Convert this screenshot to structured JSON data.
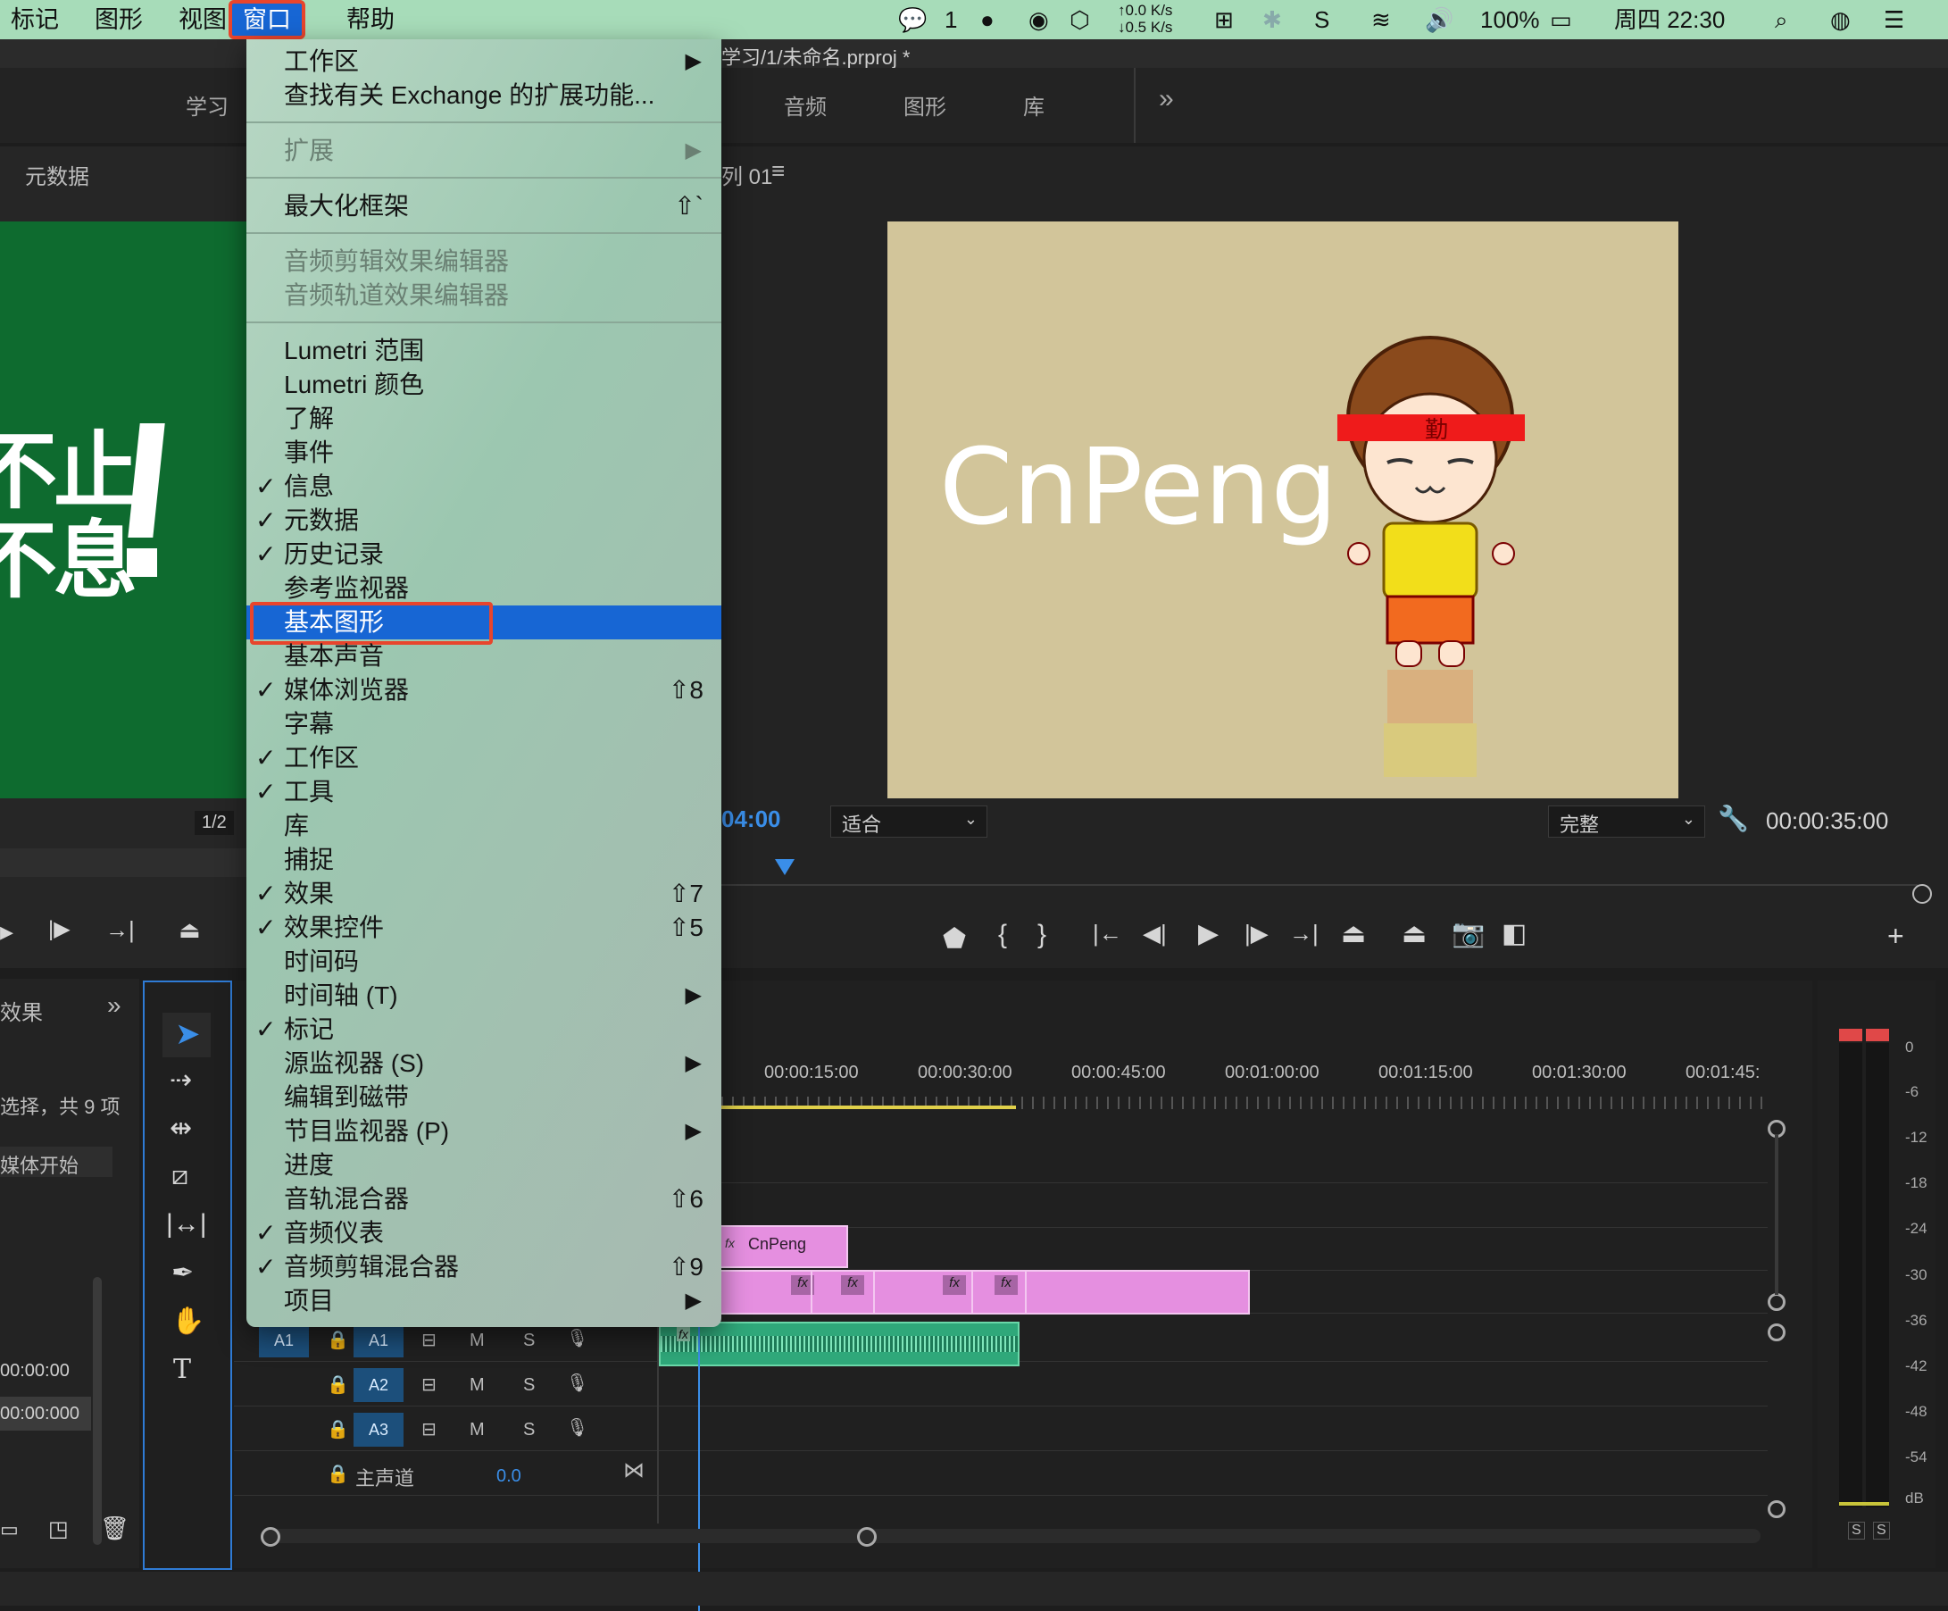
{
  "menubar": {
    "items": [
      "标记",
      "图形",
      "视图",
      "窗口",
      "帮助"
    ],
    "active": "窗口",
    "status": {
      "wechat_count": "1",
      "net_up": "↑0.0 K/s",
      "net_down": "↓0.5 K/s",
      "battery": "100%",
      "clock": "周四 22:30"
    }
  },
  "titlebar": {
    "project_path": "学习/1/未命名.prproj *"
  },
  "workspaces": [
    "学习",
    "音频",
    "图形",
    "库"
  ],
  "source_panel": {
    "title": "元数据",
    "poster_line1": "不止",
    "poster_line2": "不息",
    "page_indicator": "1/2"
  },
  "program_panel": {
    "sequence_name": "序列 01",
    "sequence_suffix": "列 01",
    "preview_text": "CnPeng",
    "headband_char": "勤",
    "current_time": "04:00",
    "fit_select": "适合",
    "quality_select": "完整",
    "duration": "00:00:35:00"
  },
  "project_panel": {
    "tab": "效果",
    "selection_info": "选择，共 9 项",
    "column": "媒体开始",
    "row1": "00:00:00",
    "row2": "00:00:000"
  },
  "timeline": {
    "ruler": [
      "00:00:15:00",
      "00:00:30:00",
      "00:00:45:00",
      "00:01:00:00",
      "00:01:15:00",
      "00:01:30:00",
      "00:01:45:"
    ],
    "tracks": [
      {
        "src": "A1",
        "name": "A1",
        "m": "M",
        "s": "S"
      },
      {
        "src": "",
        "name": "A2",
        "m": "M",
        "s": "S"
      },
      {
        "src": "",
        "name": "A3",
        "m": "M",
        "s": "S"
      }
    ],
    "master_label": "主声道",
    "master_value": "0.0",
    "clip_title": "CnPeng",
    "fx": "fx"
  },
  "audio_meter": {
    "scale": [
      "0",
      "-6",
      "-12",
      "-18",
      "-24",
      "-30",
      "-36",
      "-42",
      "-48",
      "-54",
      "dB"
    ],
    "solo": [
      "S",
      "S"
    ]
  },
  "window_menu": {
    "items": [
      {
        "label": "工作区",
        "check": false,
        "shortcut": "",
        "submenu": true,
        "disabled": false
      },
      {
        "label": "查找有关 Exchange 的扩展功能...",
        "check": false,
        "shortcut": "",
        "submenu": false,
        "disabled": false
      },
      {
        "label": "扩展",
        "check": false,
        "shortcut": "",
        "submenu": true,
        "disabled": true
      },
      {
        "label": "最大化框架",
        "check": false,
        "shortcut": "⇧`",
        "submenu": false,
        "disabled": false
      },
      {
        "label": "音频剪辑效果编辑器",
        "check": false,
        "shortcut": "",
        "submenu": false,
        "disabled": true
      },
      {
        "label": "音频轨道效果编辑器",
        "check": false,
        "shortcut": "",
        "submenu": false,
        "disabled": true
      },
      {
        "label": "Lumetri 范围",
        "check": false,
        "shortcut": "",
        "submenu": false,
        "disabled": false
      },
      {
        "label": "Lumetri 颜色",
        "check": false,
        "shortcut": "",
        "submenu": false,
        "disabled": false
      },
      {
        "label": "了解",
        "check": false,
        "shortcut": "",
        "submenu": false,
        "disabled": false
      },
      {
        "label": "事件",
        "check": false,
        "shortcut": "",
        "submenu": false,
        "disabled": false
      },
      {
        "label": "信息",
        "check": true,
        "shortcut": "",
        "submenu": false,
        "disabled": false
      },
      {
        "label": "元数据",
        "check": true,
        "shortcut": "",
        "submenu": false,
        "disabled": false
      },
      {
        "label": "历史记录",
        "check": true,
        "shortcut": "",
        "submenu": false,
        "disabled": false
      },
      {
        "label": "参考监视器",
        "check": false,
        "shortcut": "",
        "submenu": false,
        "disabled": false
      },
      {
        "label": "基本图形",
        "check": false,
        "shortcut": "",
        "submenu": false,
        "disabled": false,
        "highlighted": true
      },
      {
        "label": "基本声音",
        "check": false,
        "shortcut": "",
        "submenu": false,
        "disabled": false
      },
      {
        "label": "媒体浏览器",
        "check": true,
        "shortcut": "⇧8",
        "submenu": false,
        "disabled": false
      },
      {
        "label": "字幕",
        "check": false,
        "shortcut": "",
        "submenu": false,
        "disabled": false
      },
      {
        "label": "工作区",
        "check": true,
        "shortcut": "",
        "submenu": false,
        "disabled": false
      },
      {
        "label": "工具",
        "check": true,
        "shortcut": "",
        "submenu": false,
        "disabled": false
      },
      {
        "label": "库",
        "check": false,
        "shortcut": "",
        "submenu": false,
        "disabled": false
      },
      {
        "label": "捕捉",
        "check": false,
        "shortcut": "",
        "submenu": false,
        "disabled": false
      },
      {
        "label": "效果",
        "check": true,
        "shortcut": "⇧7",
        "submenu": false,
        "disabled": false
      },
      {
        "label": "效果控件",
        "check": true,
        "shortcut": "⇧5",
        "submenu": false,
        "disabled": false
      },
      {
        "label": "时间码",
        "check": false,
        "shortcut": "",
        "submenu": false,
        "disabled": false
      },
      {
        "label": "时间轴 (T)",
        "check": false,
        "shortcut": "",
        "submenu": true,
        "disabled": false
      },
      {
        "label": "标记",
        "check": true,
        "shortcut": "",
        "submenu": false,
        "disabled": false
      },
      {
        "label": "源监视器 (S)",
        "check": false,
        "shortcut": "",
        "submenu": true,
        "disabled": false
      },
      {
        "label": "编辑到磁带",
        "check": false,
        "shortcut": "",
        "submenu": false,
        "disabled": false
      },
      {
        "label": "节目监视器 (P)",
        "check": false,
        "shortcut": "",
        "submenu": true,
        "disabled": false
      },
      {
        "label": "进度",
        "check": false,
        "shortcut": "",
        "submenu": false,
        "disabled": false
      },
      {
        "label": "音轨混合器",
        "check": false,
        "shortcut": "⇧6",
        "submenu": false,
        "disabled": false
      },
      {
        "label": "音频仪表",
        "check": true,
        "shortcut": "",
        "submenu": false,
        "disabled": false
      },
      {
        "label": "音频剪辑混合器",
        "check": true,
        "shortcut": "⇧9",
        "submenu": false,
        "disabled": false
      },
      {
        "label": "项目",
        "check": false,
        "shortcut": "",
        "submenu": true,
        "disabled": false
      }
    ]
  },
  "glyphs": {
    "check": "✓",
    "submenu_arrow": "▶"
  }
}
